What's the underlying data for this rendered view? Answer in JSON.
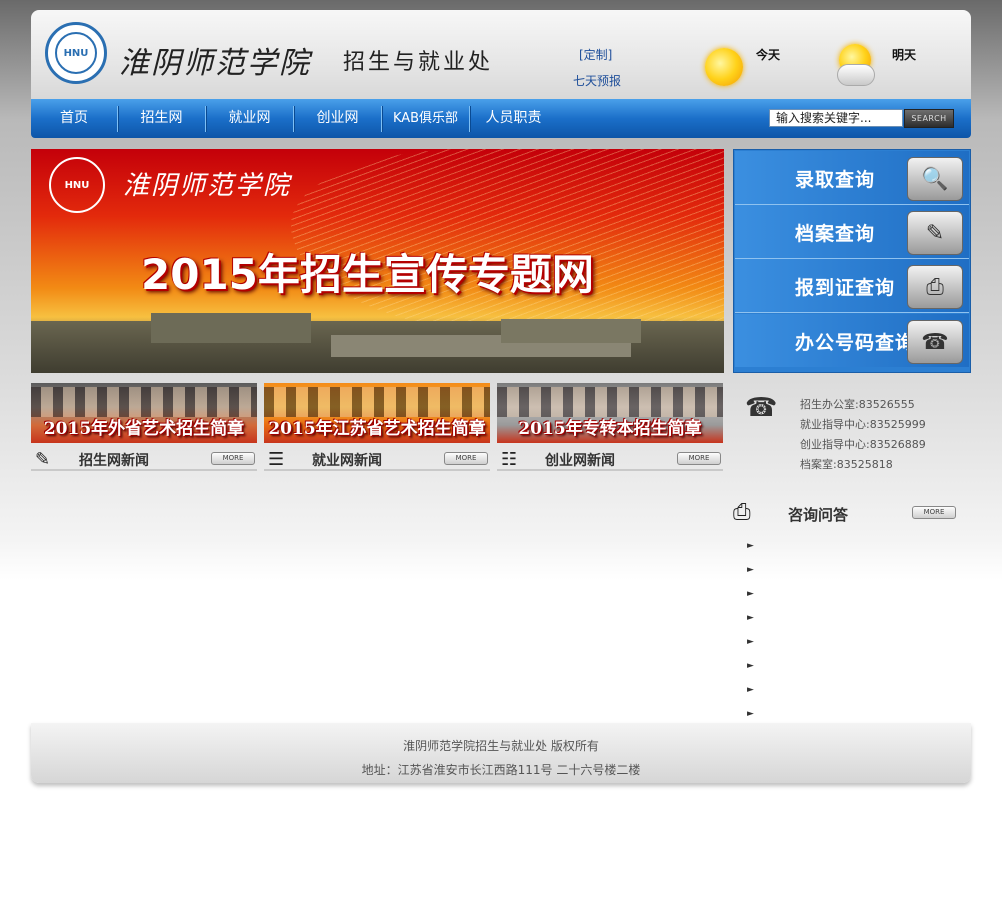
{
  "header": {
    "seal_text": "HNU",
    "logo_name": "淮阴师范学院",
    "logo_sub": "招生与就业处",
    "weather_custom": "[定制]",
    "weather_7day": "七天预报",
    "today_label": "今天",
    "tomorrow_label": "明天"
  },
  "nav": {
    "items": [
      "首页",
      "招生网",
      "就业网",
      "创业网",
      "KAB俱乐部",
      "人员职责"
    ],
    "search_placeholder": "输入搜索关键字...",
    "search_button": "SEARCH"
  },
  "banner": {
    "seal_text": "HNU",
    "school_name": "淮阴师范学院",
    "title": "2015年招生宣传专题网"
  },
  "query": {
    "items": [
      {
        "label": "录取查询",
        "icon": "magnifier-icon"
      },
      {
        "label": "档案查询",
        "icon": "notebook-icon"
      },
      {
        "label": "报到证查询",
        "icon": "printer-icon"
      },
      {
        "label": "办公号码查询",
        "icon": "fax-icon"
      }
    ]
  },
  "thumbs": [
    "2015年外省艺术招生简章",
    "2015年江苏省艺术招生简章",
    "2015年专转本招生简章"
  ],
  "news": {
    "sections": [
      "招生网新闻",
      "就业网新闻",
      "创业网新闻"
    ],
    "more_label": "MORE"
  },
  "contact": {
    "lines": [
      {
        "label": "招生办公室:",
        "number": "83526555"
      },
      {
        "label": "就业指导中心:",
        "number": "83525999"
      },
      {
        "label": "创业指导中心:",
        "number": "83526889"
      },
      {
        "label": "档案室:",
        "number": "83525818"
      }
    ]
  },
  "consult": {
    "title": "咨询问答",
    "more_label": "MORE",
    "item_count": 8
  },
  "footer": {
    "copyright": "淮阴师范学院招生与就业处  版权所有",
    "address": "地址：江苏省淮安市长江西路111号  二十六号楼二楼"
  },
  "colors": {
    "nav_blue": "#1b6fc9",
    "query_blue": "#2c7fd2",
    "link_blue": "#1f4f9a"
  }
}
